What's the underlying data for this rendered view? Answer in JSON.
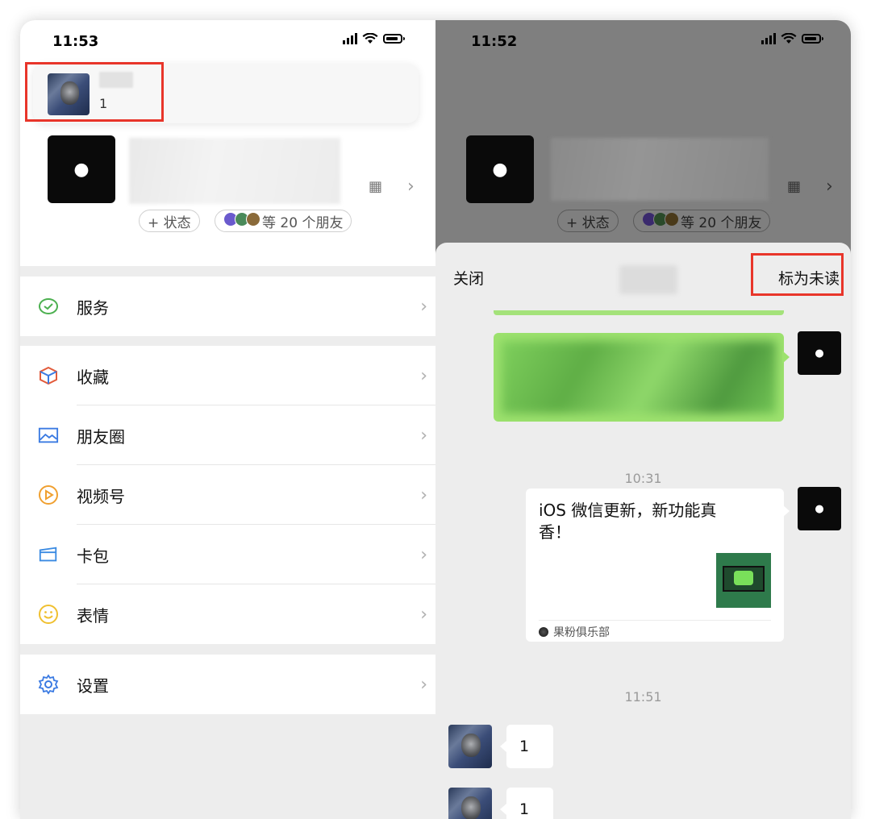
{
  "left": {
    "status_time": "11:53",
    "float_chat": {
      "count": "1"
    },
    "profile": {
      "status_pill": "+ 状态",
      "friends_pill": "等 20 个朋友"
    },
    "menu": [
      {
        "label": "服务",
        "icon": "service-icon"
      },
      {
        "label": "收藏",
        "icon": "favorites-icon"
      },
      {
        "label": "朋友圈",
        "icon": "moments-icon"
      },
      {
        "label": "视频号",
        "icon": "channels-icon"
      },
      {
        "label": "卡包",
        "icon": "card-wallet-icon"
      },
      {
        "label": "表情",
        "icon": "sticker-icon"
      },
      {
        "label": "设置",
        "icon": "settings-icon"
      }
    ]
  },
  "right": {
    "status_time": "11:52",
    "profile": {
      "status_pill": "+ 状态",
      "friends_pill": "等 20 个朋友"
    },
    "sheet": {
      "close_label": "关闭",
      "mark_unread_label": "标为未读"
    },
    "chat": {
      "time1": "10:31",
      "card_title": "iOS 微信更新，新功能真香！",
      "card_source": "果粉俱乐部",
      "time2": "11:51",
      "messages": [
        {
          "text": "1"
        },
        {
          "text": "1"
        }
      ]
    }
  },
  "colors": {
    "highlight_red": "#e8352a",
    "wechat_green": "#9de26e"
  }
}
